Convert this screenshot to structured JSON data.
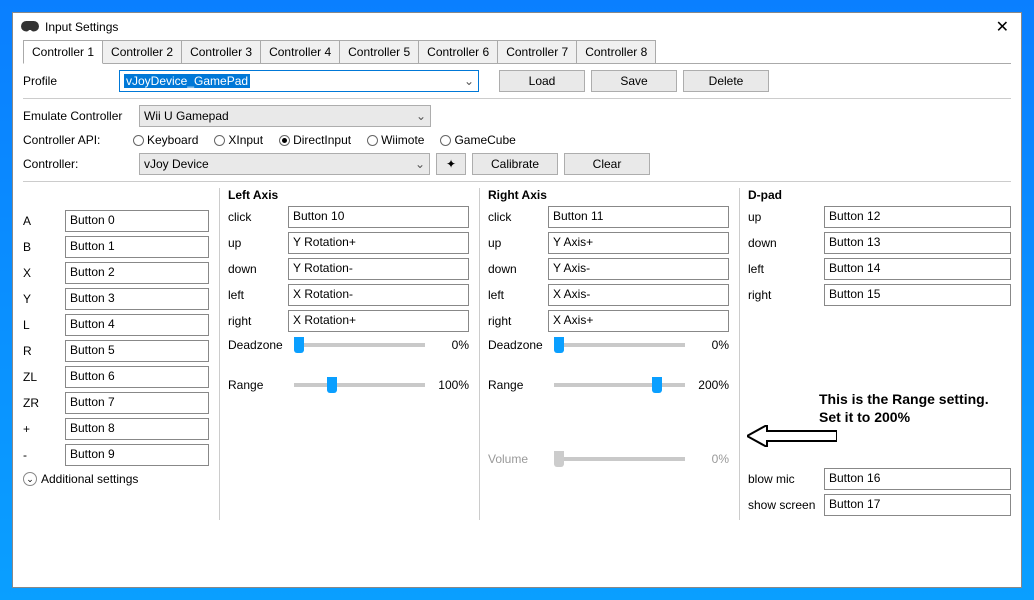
{
  "window": {
    "title": "Input Settings",
    "close": "✕"
  },
  "tabs": [
    "Controller 1",
    "Controller 2",
    "Controller 3",
    "Controller 4",
    "Controller 5",
    "Controller 6",
    "Controller 7",
    "Controller 8"
  ],
  "profile": {
    "label": "Profile",
    "value": "vJoyDevice_GamePad",
    "btnLoad": "Load",
    "btnSave": "Save",
    "btnDelete": "Delete"
  },
  "emulate": {
    "label": "Emulate Controller",
    "value": "Wii U Gamepad"
  },
  "api": {
    "label": "Controller API:",
    "options": [
      "Keyboard",
      "XInput",
      "DirectInput",
      "Wiimote",
      "GameCube"
    ],
    "selected": 2
  },
  "controller": {
    "label": "Controller:",
    "value": "vJoy Device",
    "btnCalibrate": "Calibrate",
    "btnClear": "Clear"
  },
  "buttons": {
    "A": "Button 0",
    "B": "Button 1",
    "X": "Button 2",
    "Y": "Button 3",
    "L": "Button 4",
    "R": "Button 5",
    "ZL": "Button 6",
    "ZR": "Button 7",
    "+": "Button 8",
    "-": "Button 9"
  },
  "leftAxis": {
    "title": "Left Axis",
    "click": "Button 10",
    "up": "Y Rotation+",
    "down": "Y Rotation-",
    "left": "X Rotation-",
    "right": "X Rotation+",
    "deadzoneLabel": "Deadzone",
    "deadzonePct": "0%",
    "rangeLabel": "Range",
    "rangePct": "100%",
    "rangePos": 25
  },
  "rightAxis": {
    "title": "Right Axis",
    "click": "Button 11",
    "up": "Y Axis+",
    "down": "Y Axis-",
    "left": "X Axis-",
    "right": "X Axis+",
    "deadzoneLabel": "Deadzone",
    "deadzonePct": "0%",
    "rangeLabel": "Range",
    "rangePct": "200%",
    "rangePos": 75,
    "volumeLabel": "Volume",
    "volumePct": "0%"
  },
  "dpad": {
    "title": "D-pad",
    "up": "Button 12",
    "down": "Button 13",
    "left": "Button 14",
    "right": "Button 15",
    "blowLabel": "blow mic",
    "blow": "Button 16",
    "showLabel": "show screen",
    "show": "Button 17"
  },
  "labels": {
    "click": "click",
    "up": "up",
    "down": "down",
    "left": "left",
    "right": "right"
  },
  "additional": "Additional settings",
  "annotation": "This is the Range setting. Set it to 200%"
}
